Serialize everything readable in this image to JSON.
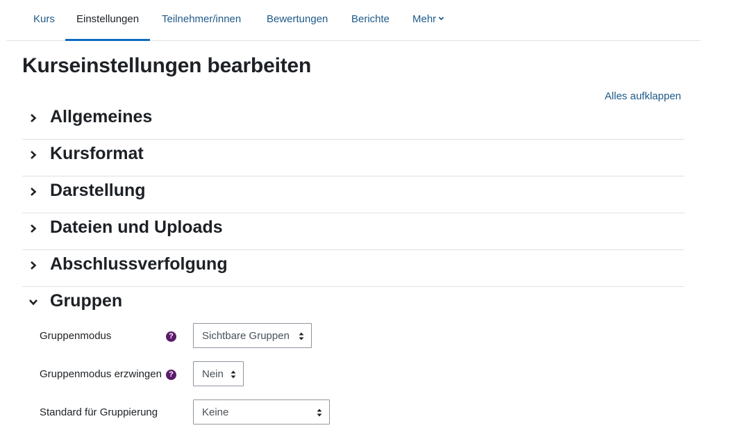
{
  "nav": {
    "tabs": [
      {
        "label": "Kurs"
      },
      {
        "label": "Einstellungen"
      },
      {
        "label": "Teilnehmer/innen"
      },
      {
        "label": "Bewertungen"
      },
      {
        "label": "Berichte"
      },
      {
        "label": "Mehr"
      }
    ],
    "active_tab": "Einstellungen"
  },
  "page": {
    "title": "Kurseinstellungen bearbeiten",
    "expand_all": "Alles aufklappen"
  },
  "sections": [
    {
      "title": "Allgemeines",
      "expanded": false
    },
    {
      "title": "Kursformat",
      "expanded": false
    },
    {
      "title": "Darstellung",
      "expanded": false
    },
    {
      "title": "Dateien und Uploads",
      "expanded": false
    },
    {
      "title": "Abschlussverfolgung",
      "expanded": false
    },
    {
      "title": "Gruppen",
      "expanded": true
    }
  ],
  "groups_form": {
    "fields": [
      {
        "label": "Gruppenmodus",
        "value": "Sichtbare Gruppen",
        "help": "?"
      },
      {
        "label": "Gruppenmodus erzwingen",
        "value": "Nein",
        "help": "?"
      },
      {
        "label": "Standard für Gruppierung",
        "value": "Keine"
      }
    ]
  },
  "colors": {
    "link": "#1e5a8a",
    "active_underline": "#0f6cbf",
    "help_icon": "#5b1b6b",
    "text": "#1d2125"
  }
}
